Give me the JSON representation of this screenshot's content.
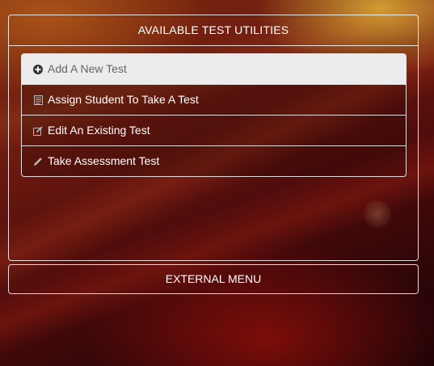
{
  "utilities_panel": {
    "heading": "AVAILABLE TEST UTILITIES",
    "items": [
      {
        "label": "Add A New Test",
        "icon": "plus-circle-icon"
      },
      {
        "label": "Assign Student To Take A Test",
        "icon": "list-icon"
      },
      {
        "label": "Edit An Existing Test",
        "icon": "edit-icon"
      },
      {
        "label": "Take Assessment Test",
        "icon": "pencil-icon"
      }
    ]
  },
  "external_menu": {
    "label": "EXTERNAL MENU"
  }
}
